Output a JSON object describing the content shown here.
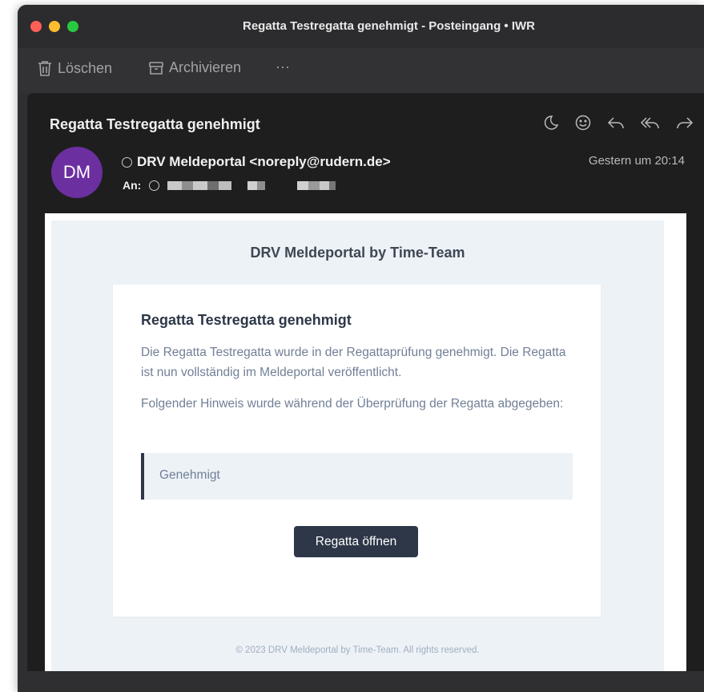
{
  "window": {
    "title": "Regatta Testregatta genehmigt - Posteingang • IWR"
  },
  "toolbar": {
    "delete_label": "Löschen",
    "archive_label": "Archivieren",
    "more_label": "···"
  },
  "message": {
    "subject": "Regatta Testregatta genehmigt",
    "avatar_initials": "DM",
    "avatar_color": "#6b2fa0",
    "sender": "DRV Meldeportal <noreply@rudern.de>",
    "to_label": "An:",
    "date": "Gestern um 20:14"
  },
  "email": {
    "brand": "DRV Meldeportal by Time-Team",
    "card_title": "Regatta Testregatta genehmigt",
    "paragraph1": "Die Regatta Testregatta wurde in der Regattaprüfung genehmigt. Die Regatta ist nun vollständig im Meldeportal veröffentlicht.",
    "paragraph2": "Folgender Hinweis wurde während der Überprüfung der Regatta abgegeben:",
    "note": "Genehmigt",
    "button_label": "Regatta öffnen",
    "footer": "© 2023 DRV Meldeportal by Time-Team. All rights reserved."
  },
  "colors": {
    "accent_button": "#2d3748",
    "email_background": "#edf2f7"
  }
}
